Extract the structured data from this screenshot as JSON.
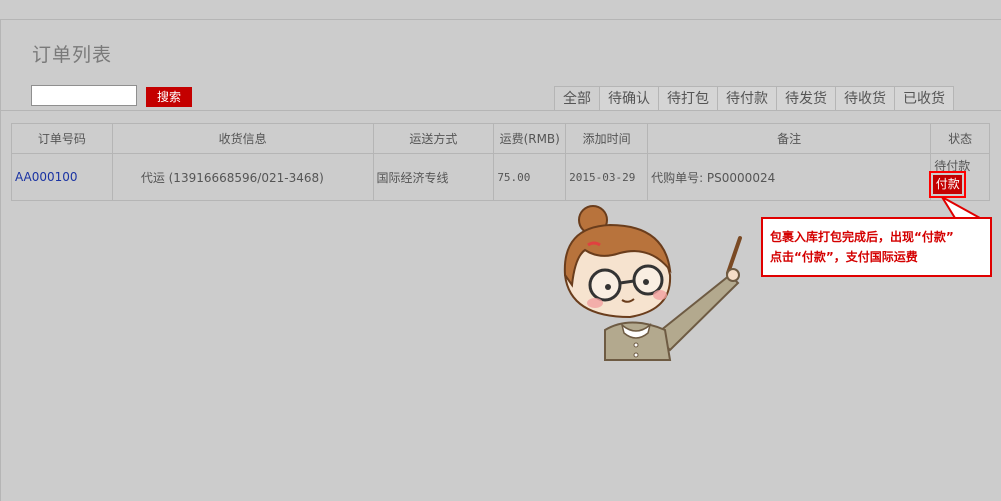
{
  "page": {
    "title": "订单列表"
  },
  "search": {
    "value": "",
    "button_label": "搜索"
  },
  "tabs": [
    {
      "label": "全部",
      "active": true
    },
    {
      "label": "待确认"
    },
    {
      "label": "待打包"
    },
    {
      "label": "待付款"
    },
    {
      "label": "待发货"
    },
    {
      "label": "待收货"
    },
    {
      "label": "已收货"
    }
  ],
  "table": {
    "columns": [
      "订单号码",
      "收货信息",
      "运送方式",
      "运费(RMB)",
      "添加时间",
      "备注",
      "状态"
    ],
    "rows": [
      {
        "order_no": "AA000100",
        "receiver": "代运 (13916668596/021-3468)",
        "shipping": "国际经济专线",
        "fee": "75.00",
        "added": "2015-03-29",
        "remark": "代购单号: PS0000024",
        "status": "待付款",
        "action": "付款"
      }
    ]
  },
  "callout": {
    "line1": "包裹入库打包完成后，出现“付款”",
    "line2": "点击“付款”，支付国际运费"
  },
  "colors": {
    "accent": "#c40000",
    "link": "#1a33a3",
    "background": "#cccccc"
  }
}
